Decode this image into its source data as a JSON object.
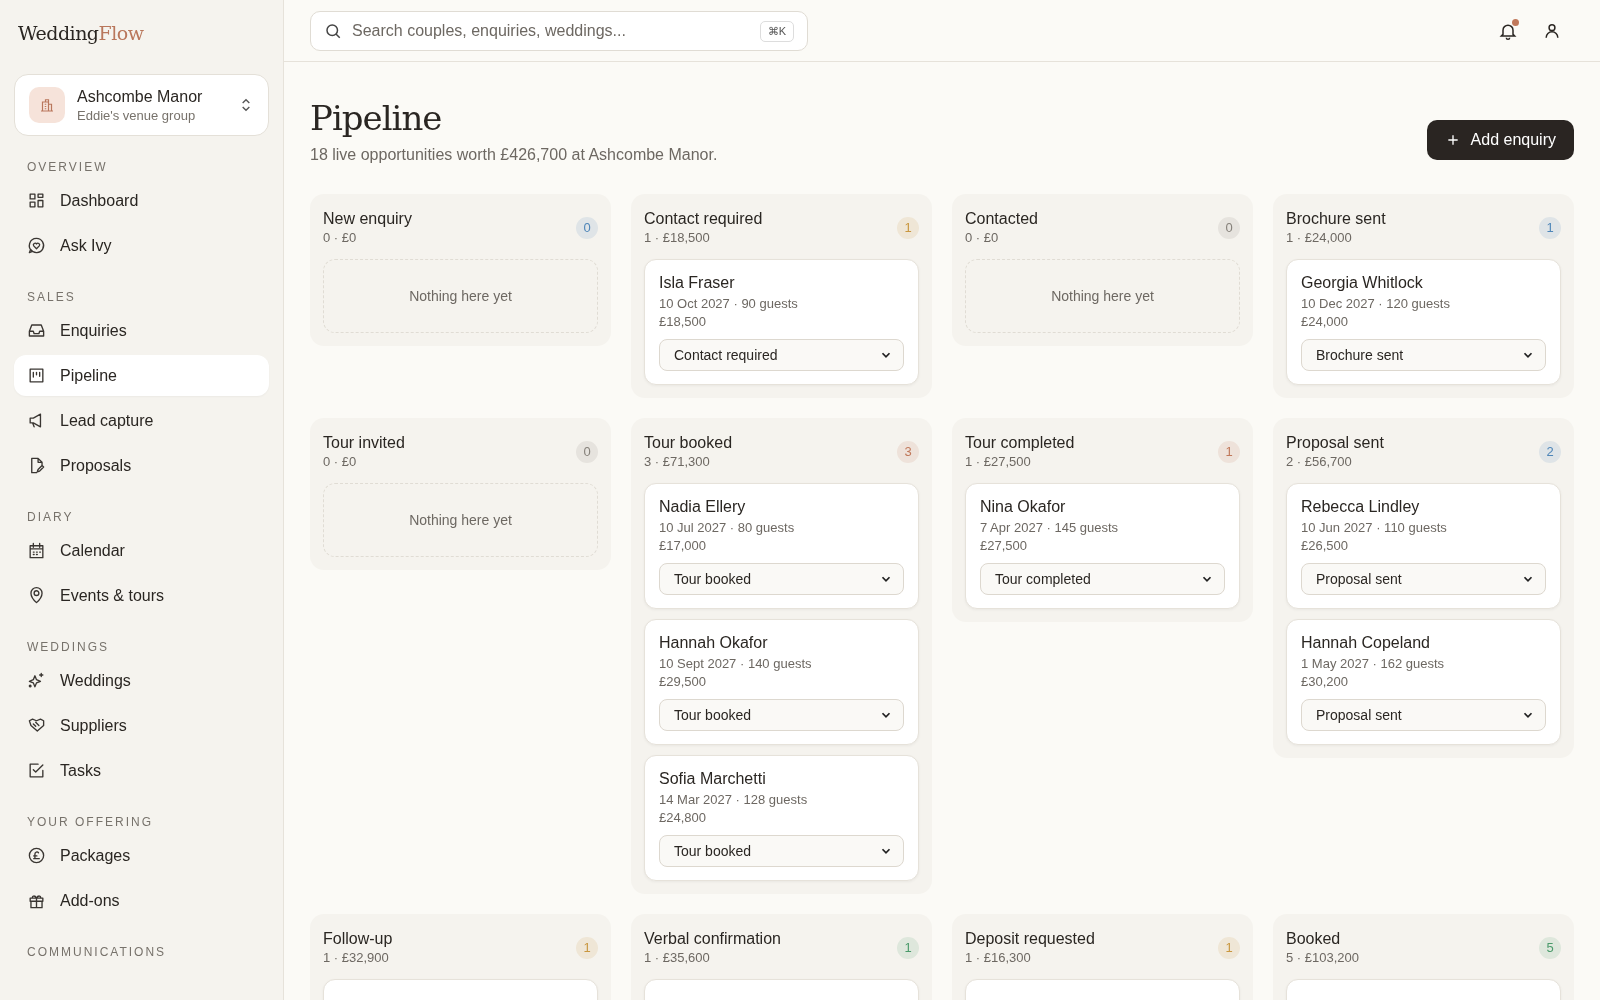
{
  "brand": {
    "part_1": "Wedding",
    "part_2": "Flow"
  },
  "venue": {
    "name": "Ashcombe Manor",
    "group": "Eddie's venue group"
  },
  "sidebar": {
    "sections": [
      {
        "label": "OVERVIEW",
        "items": [
          {
            "label": "Dashboard",
            "selected": false
          },
          {
            "label": "Ask Ivy",
            "selected": false
          }
        ]
      },
      {
        "label": "SALES",
        "items": [
          {
            "label": "Enquiries",
            "selected": false
          },
          {
            "label": "Pipeline",
            "selected": true
          },
          {
            "label": "Lead capture",
            "selected": false
          },
          {
            "label": "Proposals",
            "selected": false
          }
        ]
      },
      {
        "label": "DIARY",
        "items": [
          {
            "label": "Calendar",
            "selected": false
          },
          {
            "label": "Events & tours",
            "selected": false
          }
        ]
      },
      {
        "label": "WEDDINGS",
        "items": [
          {
            "label": "Weddings",
            "selected": false
          },
          {
            "label": "Suppliers",
            "selected": false
          },
          {
            "label": "Tasks",
            "selected": false
          }
        ]
      },
      {
        "label": "YOUR OFFERING",
        "items": [
          {
            "label": "Packages",
            "selected": false
          },
          {
            "label": "Add-ons",
            "selected": false
          }
        ]
      },
      {
        "label": "COMMUNICATIONS"
      }
    ]
  },
  "search": {
    "placeholder": "Search couples, enquiries, weddings...",
    "shortcut": "⌘K"
  },
  "notifications": {
    "unread": true
  },
  "page": {
    "title": "Pipeline",
    "subtitle": "18 live opportunities worth £426,700 at Ashcombe Manor.",
    "action": "Add enquiry"
  },
  "columns": [
    {
      "title": "New enquiry",
      "summary": "0 · £0",
      "count": "0",
      "color": "#4f86b8",
      "empty_text": "Nothing here yet"
    },
    {
      "title": "Contact required",
      "summary": "1 · £18,500",
      "count": "1",
      "color": "#c9973f",
      "cards": [
        {
          "name": "Isla Fraser",
          "details": "10 Oct 2027 · 90 guests",
          "value": "£18,500",
          "stage": "Contact required"
        }
      ]
    },
    {
      "title": "Contacted",
      "summary": "0 · £0",
      "count": "0",
      "color": "#86817a",
      "empty_text": "Nothing here yet"
    },
    {
      "title": "Brochure sent",
      "summary": "1 · £24,000",
      "count": "1",
      "color": "#4f86b8",
      "cards": [
        {
          "name": "Georgia Whitlock",
          "details": "10 Dec 2027 · 120 guests",
          "value": "£24,000",
          "stage": "Brochure sent"
        }
      ]
    },
    {
      "title": "Tour invited",
      "summary": "0 · £0",
      "count": "0",
      "color": "#86817a",
      "empty_text": "Nothing here yet"
    },
    {
      "title": "Tour booked",
      "summary": "3 · £71,300",
      "count": "3",
      "color": "#c0785a",
      "cards": [
        {
          "name": "Nadia Ellery",
          "details": "10 Jul 2027 · 80 guests",
          "value": "£17,000",
          "stage": "Tour booked"
        },
        {
          "name": "Hannah Okafor",
          "details": "10 Sept 2027 · 140 guests",
          "value": "£29,500",
          "stage": "Tour booked"
        },
        {
          "name": "Sofia Marchetti",
          "details": "14 Mar 2027 · 128 guests",
          "value": "£24,800",
          "stage": "Tour booked"
        }
      ]
    },
    {
      "title": "Tour completed",
      "summary": "1 · £27,500",
      "count": "1",
      "color": "#c0785a",
      "cards": [
        {
          "name": "Nina Okafor",
          "details": "7 Apr 2027 · 145 guests",
          "value": "£27,500",
          "stage": "Tour completed"
        }
      ]
    },
    {
      "title": "Proposal sent",
      "summary": "2 · £56,700",
      "count": "2",
      "color": "#4f86b8",
      "cards": [
        {
          "name": "Rebecca Lindley",
          "details": "10 Jun 2027 · 110 guests",
          "value": "£26,500",
          "stage": "Proposal sent"
        },
        {
          "name": "Hannah Copeland",
          "details": "1 May 2027 · 162 guests",
          "value": "£30,200",
          "stage": "Proposal sent"
        }
      ]
    },
    {
      "title": "Follow-up",
      "summary": "1 · £32,900",
      "count": "1",
      "color": "#c9973f",
      "cards": [
        {
          "cut_off": true
        }
      ]
    },
    {
      "title": "Verbal confirmation",
      "summary": "1 · £35,600",
      "count": "1",
      "color": "#4a9a6a",
      "cards": [
        {
          "cut_off": true
        }
      ]
    },
    {
      "title": "Deposit requested",
      "summary": "1 · £16,300",
      "count": "1",
      "color": "#c9973f",
      "cards": [
        {
          "cut_off": true
        }
      ]
    },
    {
      "title": "Booked",
      "summary": "5 · £103,200",
      "count": "5",
      "color": "#4a9a6a",
      "cards": [
        {
          "cut_off": true
        }
      ]
    }
  ]
}
